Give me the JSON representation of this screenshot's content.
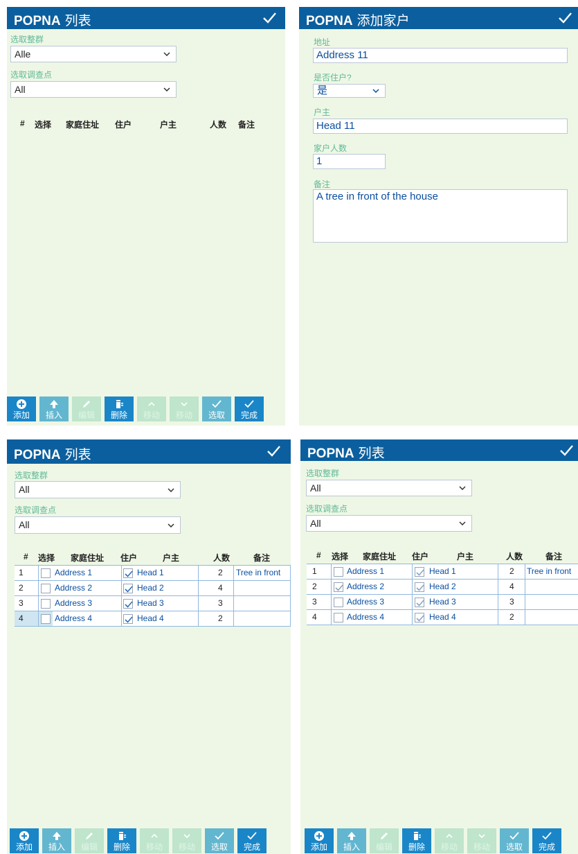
{
  "list_title": "POPNA",
  "list_title_suffix": "列表",
  "add_title_suffix": "添加家户",
  "filter": {
    "cluster_label": "选取整群",
    "point_label": "选取调查点",
    "cluster_value_p1": "Alle",
    "cluster_value": "All",
    "point_value": "All"
  },
  "columns": [
    "#",
    "选择",
    "家庭住址",
    "住户",
    "户主",
    "人数",
    "备注"
  ],
  "rows": [
    {
      "num": "1",
      "address": "Address 1",
      "head": "Head 1",
      "count": "2",
      "note": "Tree in front"
    },
    {
      "num": "2",
      "address": "Address 2",
      "head": "Head 2",
      "count": "4",
      "note": ""
    },
    {
      "num": "3",
      "address": "Address 3",
      "head": "Head 3",
      "count": "3",
      "note": ""
    },
    {
      "num": "4",
      "address": "Address 4",
      "head": "Head 4",
      "count": "2",
      "note": ""
    }
  ],
  "panel3_checks": {
    "select": [
      false,
      false,
      false,
      false
    ],
    "resident": [
      true,
      true,
      true,
      true
    ]
  },
  "panel4_checks": {
    "select": [
      false,
      true,
      false,
      false
    ],
    "resident": [
      true,
      true,
      true,
      true
    ]
  },
  "form": {
    "address_label": "地址",
    "address_value": "Address 11",
    "resident_label": "是否住户?",
    "resident_value": "是",
    "head_label": "户主",
    "head_value": "Head 11",
    "count_label": "家户人数",
    "count_value": "1",
    "note_label": "备注",
    "note_value": "A tree in front of the house"
  },
  "toolbar": {
    "add": "添加",
    "insert": "插入",
    "edit": "编辑",
    "delete": "删除",
    "move_up": "移动",
    "move_down": "移动",
    "select": "选取",
    "done": "完成"
  },
  "icons": [
    "plus-circle-icon",
    "arrow-up-icon",
    "pencil-icon",
    "trash-icon",
    "chevron-up-icon",
    "chevron-down-icon",
    "check-icon"
  ],
  "colors": {
    "header": "#0b5f9e",
    "background": "#eef7e5",
    "label": "#62b99a",
    "button": "#1a86c8",
    "button_disabled": "#bfe5cc",
    "link_text": "#0b4fa0"
  }
}
